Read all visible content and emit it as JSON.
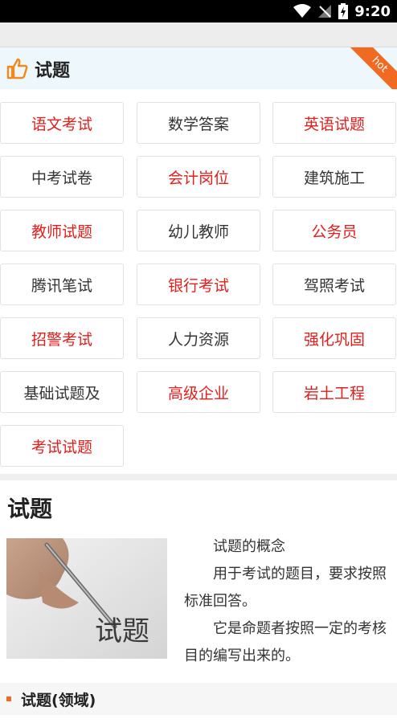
{
  "status_bar": {
    "time": "9:20"
  },
  "header": {
    "title": "试题",
    "ribbon": "hot"
  },
  "grid": {
    "rows": [
      [
        {
          "label": "语文考试",
          "red": true
        },
        {
          "label": "数学答案",
          "red": false
        },
        {
          "label": "英语试题",
          "red": true
        }
      ],
      [
        {
          "label": "中考试卷",
          "red": false
        },
        {
          "label": "会计岗位",
          "red": true
        },
        {
          "label": "建筑施工",
          "red": false
        }
      ],
      [
        {
          "label": "教师试题",
          "red": true
        },
        {
          "label": "幼儿教师",
          "red": false
        },
        {
          "label": "公务员",
          "red": true
        }
      ],
      [
        {
          "label": "腾讯笔试",
          "red": false
        },
        {
          "label": "银行考试",
          "red": true
        },
        {
          "label": "驾照考试",
          "red": false
        }
      ],
      [
        {
          "label": "招警考试",
          "red": true
        },
        {
          "label": "人力资源",
          "red": false
        },
        {
          "label": "强化巩固",
          "red": true
        }
      ],
      [
        {
          "label": "基础试题及",
          "red": false
        },
        {
          "label": "高级企业",
          "red": true
        },
        {
          "label": "岩土工程",
          "red": true
        }
      ],
      [
        {
          "label": "考试试题",
          "red": true
        }
      ]
    ]
  },
  "article": {
    "title": "试题",
    "image_caption": "试题",
    "paragraphs": [
      "试题的概念",
      "用于考试的题目，要求按照标准回答。",
      "它是命题者按照一定的考核目的编写出来的。"
    ]
  },
  "section": {
    "label": "试题(领域)"
  },
  "colors": {
    "accent": "#f06a22",
    "red_text": "#e41d1d",
    "header_bg": "#eef7fb"
  }
}
